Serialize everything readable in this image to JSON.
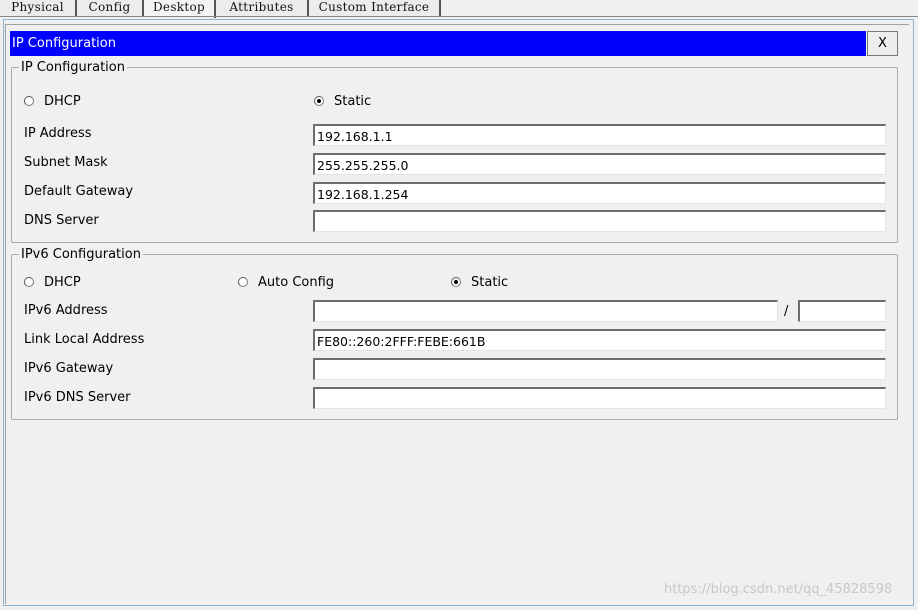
{
  "tabs": [
    {
      "label": "Physical"
    },
    {
      "label": "Config"
    },
    {
      "label": "Desktop"
    },
    {
      "label": "Attributes"
    },
    {
      "label": "Custom Interface"
    }
  ],
  "window": {
    "title": "IP Configuration",
    "close_label": "X"
  },
  "ipv4": {
    "group_title": "IP Configuration",
    "dhcp_label": "DHCP",
    "static_label": "Static",
    "selected_mode": "Static",
    "ip_address": {
      "label": "IP Address",
      "value": "192.168.1.1"
    },
    "subnet_mask": {
      "label": "Subnet Mask",
      "value": "255.255.255.0"
    },
    "default_gateway": {
      "label": "Default Gateway",
      "value": "192.168.1.254"
    },
    "dns_server": {
      "label": "DNS Server",
      "value": ""
    }
  },
  "ipv6": {
    "group_title": "IPv6 Configuration",
    "dhcp_label": "DHCP",
    "auto_config_label": "Auto Config",
    "static_label": "Static",
    "selected_mode": "Static",
    "address": {
      "label": "IPv6 Address",
      "value": "",
      "prefix_separator": "/",
      "prefix_value": ""
    },
    "link_local": {
      "label": "Link Local Address",
      "value": "FE80::260:2FFF:FEBE:661B"
    },
    "gateway": {
      "label": "IPv6 Gateway",
      "value": ""
    },
    "dns_server": {
      "label": "IPv6 DNS Server",
      "value": ""
    }
  },
  "watermark": "https://blog.csdn.net/qq_45828598"
}
